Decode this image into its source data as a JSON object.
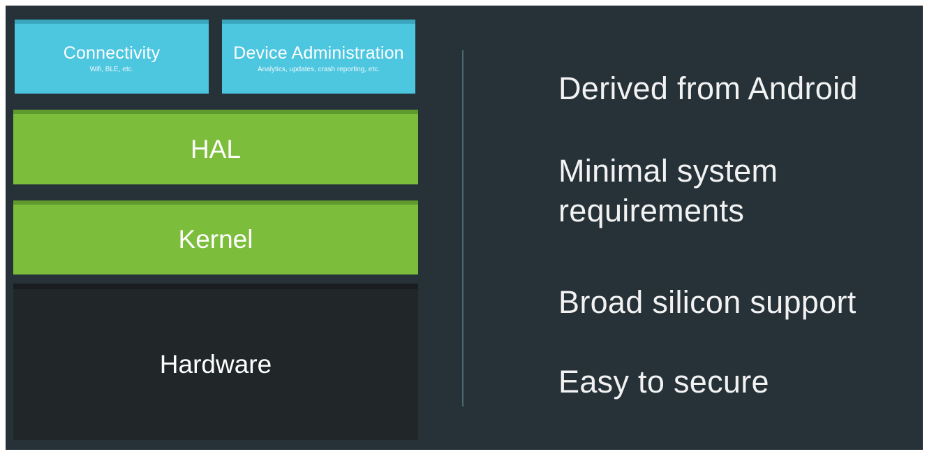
{
  "stack": {
    "connectivity": {
      "title": "Connectivity",
      "subtitle": "Wifi, BLE, etc.",
      "color": "#4dc6e0"
    },
    "device_admin": {
      "title": "Device Administration",
      "subtitle": "Analytics, updates, crash reporting, etc.",
      "color": "#4dc6e0"
    },
    "hal": {
      "title": "HAL",
      "color": "#7cbd3c"
    },
    "kernel": {
      "title": "Kernel",
      "color": "#7cbd3c"
    },
    "hardware": {
      "title": "Hardware",
      "color": "#212629"
    }
  },
  "features": [
    "Derived from Android",
    "Minimal system\nrequirements",
    "Broad silicon support",
    "Easy to secure"
  ],
  "colors": {
    "background": "#263238",
    "divider": "#4a6a72",
    "text": "#f2f2f2"
  }
}
